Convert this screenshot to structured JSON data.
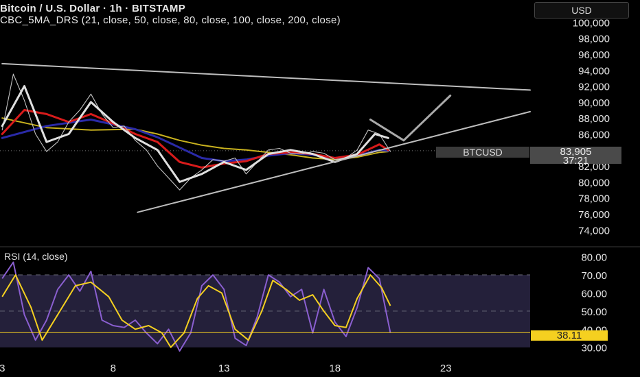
{
  "header": {
    "title": "Bitcoin / U.S. Dollar · 1h · BITSTAMP",
    "indicator": "CBC_5MA_DRS (21, close, 50, close, 80, close, 100, close, 200, close)",
    "currency": "USD"
  },
  "price_tags": {
    "symbol": "BTCUSD",
    "last_price": "83,905",
    "countdown": "37:21"
  },
  "rsi": {
    "title": "RSI (14, close)",
    "value_label": "38.11"
  },
  "colors": {
    "background": "#000000",
    "ma_white": "#e0e0e0",
    "ma_red": "#d81b1b",
    "ma_blue": "#2a2aa8",
    "ma_yellow": "#c9b21e",
    "rsi_line": "#8a5fd0",
    "rsi_ma": "#f5d020",
    "rsi_band": "#24203a",
    "trendline": "#bdbdbd"
  },
  "chart_data": [
    {
      "type": "line",
      "title": "Bitcoin / U.S. Dollar · 1h · BITSTAMP",
      "x_ticks": [
        "3",
        "8",
        "13",
        "18",
        "23"
      ],
      "y_ticks": [
        "74,000",
        "76,000",
        "78,000",
        "80,000",
        "82,000",
        "84,000",
        "86,000",
        "88,000",
        "90,000",
        "92,000",
        "94,000",
        "96,000",
        "98,000",
        "100,000"
      ],
      "ylim": [
        73600,
        100200
      ],
      "xlim": [
        2.9,
        26.8
      ],
      "last_price": 83905,
      "series": [
        {
          "name": "close",
          "x": [
            3,
            3.5,
            4,
            4.5,
            5,
            5.5,
            6,
            6.5,
            7,
            7.5,
            8,
            8.5,
            9,
            9.5,
            10,
            10.5,
            11,
            11.5,
            12,
            12.5,
            13,
            13.5,
            14,
            14.5,
            15,
            15.5,
            16,
            16.5,
            17,
            17.5,
            18,
            18.5,
            19,
            19.5,
            20,
            20.5
          ],
          "y": [
            86500,
            93500,
            90200,
            86000,
            83800,
            85000,
            87500,
            89000,
            91000,
            88500,
            86800,
            87000,
            85200,
            84000,
            82000,
            80500,
            79000,
            80500,
            81500,
            82800,
            82600,
            83000,
            81000,
            82500,
            84000,
            84200,
            83600,
            83500,
            83800,
            83600,
            82800,
            83000,
            84000,
            86500,
            86000,
            83800
          ]
        },
        {
          "name": "MA21",
          "x": [
            3,
            4,
            5,
            6,
            7,
            8,
            9,
            10,
            11,
            12,
            13,
            14,
            15,
            16,
            17,
            18,
            19,
            19.8,
            20.4
          ],
          "y": [
            87000,
            92000,
            85000,
            86000,
            90000,
            87500,
            85500,
            84000,
            80000,
            81000,
            82500,
            81500,
            83500,
            84000,
            83500,
            82500,
            83500,
            86000,
            85500
          ]
        },
        {
          "name": "MA50",
          "x": [
            3,
            4,
            5,
            6,
            7,
            8,
            9,
            10,
            11,
            12,
            13,
            14,
            15,
            16,
            17,
            18,
            19,
            20,
            20.4
          ],
          "y": [
            86000,
            89000,
            88500,
            87500,
            88500,
            87300,
            86000,
            85000,
            82500,
            81800,
            82300,
            82600,
            83500,
            83700,
            83500,
            83000,
            83400,
            84700,
            84000
          ]
        },
        {
          "name": "MA80",
          "x": [
            3,
            5,
            7,
            9,
            10,
            11,
            12,
            13,
            14,
            15,
            16,
            17,
            18,
            19,
            20,
            20.4
          ],
          "y": [
            85500,
            87000,
            87800,
            86600,
            85600,
            84300,
            83000,
            82600,
            82800,
            83300,
            83600,
            83400,
            83000,
            83300,
            84000,
            83900
          ]
        },
        {
          "name": "MA200",
          "x": [
            3,
            5,
            7,
            9,
            10,
            11,
            12,
            13,
            14,
            15,
            16,
            17,
            18,
            19,
            20,
            20.4
          ],
          "y": [
            88000,
            86800,
            86500,
            86600,
            86000,
            85200,
            84600,
            84200,
            84000,
            83700,
            83400,
            83000,
            82800,
            83100,
            83700,
            83800
          ]
        },
        {
          "name": "upper trendline",
          "x": [
            3,
            26.8
          ],
          "y": [
            94800,
            91500
          ]
        },
        {
          "name": "lower trendline",
          "x": [
            9.1,
            26.8
          ],
          "y": [
            76200,
            88800
          ]
        },
        {
          "name": "projection",
          "x": [
            19.6,
            21.1,
            23.2
          ],
          "y": [
            87800,
            85200,
            90800
          ]
        }
      ]
    },
    {
      "type": "line",
      "title": "RSI (14, close)",
      "x_ticks": [
        "3",
        "8",
        "13",
        "18",
        "23"
      ],
      "y_ticks": [
        "30.00",
        "40.00",
        "50.00",
        "60.00",
        "70.00",
        "80.00"
      ],
      "ylim": [
        28,
        81
      ],
      "xlim": [
        2.9,
        26.8
      ],
      "bands": [
        30,
        50,
        70
      ],
      "last_value": 38.11,
      "series": [
        {
          "name": "RSI",
          "x": [
            3,
            3.5,
            4,
            4.5,
            5,
            5.5,
            6,
            6.5,
            7,
            7.5,
            8,
            8.5,
            9,
            9.5,
            10,
            10.5,
            11,
            11.5,
            12,
            12.5,
            13,
            13.5,
            14,
            14.5,
            15,
            15.5,
            16,
            16.5,
            17,
            17.5,
            18,
            18.5,
            19,
            19.5,
            20,
            20.5
          ],
          "y": [
            68,
            77,
            48,
            34,
            45,
            62,
            70,
            61,
            72,
            45,
            42,
            41,
            45,
            38,
            32,
            40,
            28,
            38,
            64,
            70,
            62,
            35,
            31,
            47,
            70,
            66,
            58,
            62,
            38,
            62,
            44,
            36,
            52,
            74,
            68,
            38
          ]
        },
        {
          "name": "RSI MA",
          "x": [
            3,
            3.6,
            4.3,
            4.8,
            5.5,
            6.3,
            7,
            7.8,
            8.4,
            9,
            9.6,
            10.2,
            10.6,
            11.2,
            11.8,
            12.3,
            12.9,
            13.5,
            14.1,
            14.7,
            15.2,
            15.8,
            16.4,
            17,
            17.5,
            18,
            18.5,
            19,
            19.6,
            20.1,
            20.5
          ],
          "y": [
            58,
            70,
            52,
            34,
            48,
            64,
            66,
            58,
            45,
            40,
            42,
            38,
            30,
            38,
            57,
            64,
            60,
            40,
            34,
            50,
            67,
            62,
            56,
            59,
            50,
            42,
            41,
            57,
            70,
            63,
            53
          ]
        }
      ]
    }
  ]
}
